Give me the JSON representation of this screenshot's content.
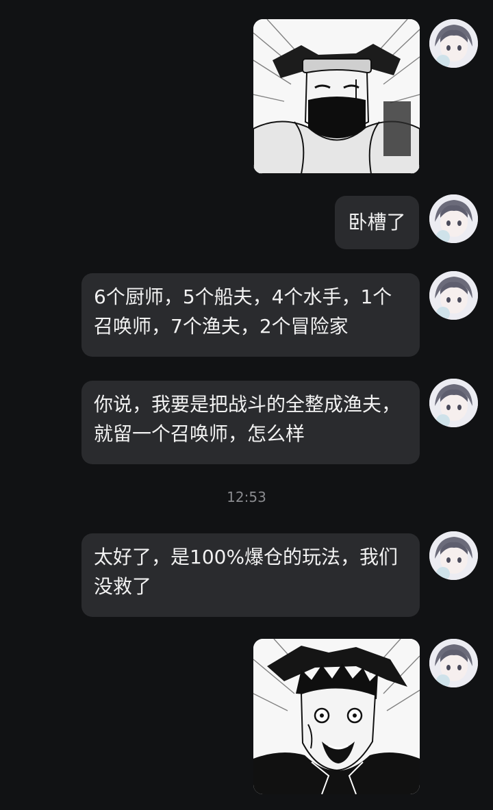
{
  "colors": {
    "background": "#111214",
    "bubble": "#2a2b2e",
    "bubble_text": "#f2f2f2",
    "timestamp_text": "#8a8b8f"
  },
  "messages": [
    {
      "type": "sticker",
      "icon": "kakashi-manga-sticker"
    },
    {
      "type": "text",
      "text": "卧槽了"
    },
    {
      "type": "text",
      "text": "6个厨师，5个船夫，4个水手，1个召唤师，7个渔夫，2个冒险家"
    },
    {
      "type": "text",
      "text": "你说，我要是把战斗的全整成渔夫，就留一个召唤师，怎么样"
    },
    {
      "type": "text",
      "text": "太好了，是100%爆仓的玩法，我们没救了"
    },
    {
      "type": "sticker",
      "icon": "obito-manga-sticker"
    }
  ],
  "timestamp": "12:53",
  "avatar_icon": "user-avatar-icon"
}
